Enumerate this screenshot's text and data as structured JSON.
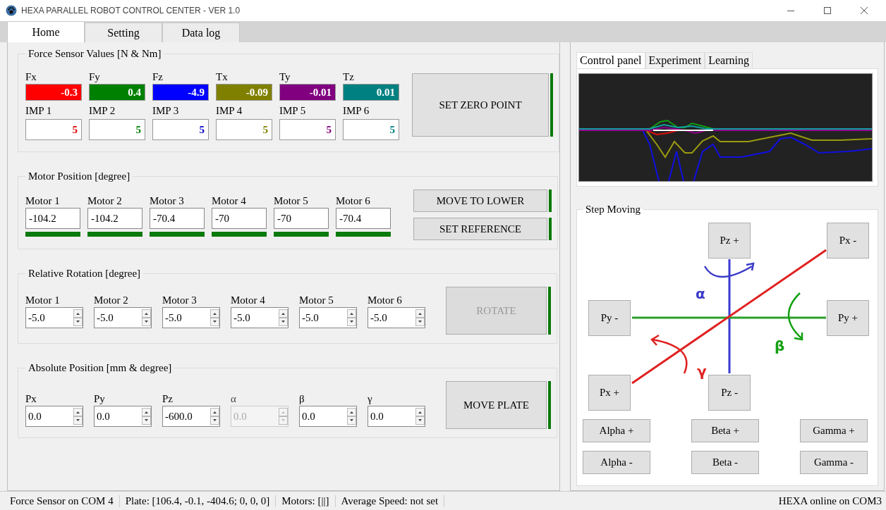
{
  "window": {
    "title": "HEXA PARALLEL ROBOT CONTROL CENTER - VER 1.0"
  },
  "tabs": [
    {
      "label": "Home",
      "selected": true
    },
    {
      "label": "Setting",
      "selected": false
    },
    {
      "label": "Data log",
      "selected": false
    }
  ],
  "force_sensor": {
    "title": "Force Sensor Values [N & Nm]",
    "values": [
      {
        "label": "Fx",
        "value": "-0.3",
        "color": "#ff0000"
      },
      {
        "label": "Fy",
        "value": "0.4",
        "color": "#008000"
      },
      {
        "label": "Fz",
        "value": "-4.9",
        "color": "#0000ff"
      },
      {
        "label": "Tx",
        "value": "-0.09",
        "color": "#808000"
      },
      {
        "label": "Ty",
        "value": "-0.01",
        "color": "#800080"
      },
      {
        "label": "Tz",
        "value": "0.01",
        "color": "#008080"
      }
    ],
    "impedance": [
      {
        "label": "IMP 1",
        "value": "5",
        "color": "#e00000"
      },
      {
        "label": "IMP 2",
        "value": "5",
        "color": "#008000"
      },
      {
        "label": "IMP 3",
        "value": "5",
        "color": "#0000c0"
      },
      {
        "label": "IMP 4",
        "value": "5",
        "color": "#808000"
      },
      {
        "label": "IMP 5",
        "value": "5",
        "color": "#800080"
      },
      {
        "label": "IMP 6",
        "value": "5",
        "color": "#008080"
      }
    ],
    "button": {
      "label": "SET ZERO POINT",
      "ready": true,
      "disabled": false
    }
  },
  "motor_position": {
    "title": "Motor Position [degree]",
    "motors": [
      {
        "label": "Motor 1",
        "value": "-104.2",
        "ok": true
      },
      {
        "label": "Motor 2",
        "value": "-104.2",
        "ok": true
      },
      {
        "label": "Motor 3",
        "value": "-70.4",
        "ok": true
      },
      {
        "label": "Motor 4",
        "value": "-70",
        "ok": true
      },
      {
        "label": "Motor 5",
        "value": "-70",
        "ok": true
      },
      {
        "label": "Motor 6",
        "value": "-70.4",
        "ok": true
      }
    ],
    "buttons": [
      {
        "label": "MOVE TO LOWER",
        "ready": true,
        "disabled": false
      },
      {
        "label": "SET REFERENCE",
        "ready": true,
        "disabled": false
      }
    ]
  },
  "relative_rotation": {
    "title": "Relative Rotation [degree]",
    "fields": [
      {
        "label": "Motor 1",
        "value": "-5.0",
        "disabled": false
      },
      {
        "label": "Motor 2",
        "value": "-5.0",
        "disabled": false
      },
      {
        "label": "Motor 3",
        "value": "-5.0",
        "disabled": false
      },
      {
        "label": "Motor 4",
        "value": "-5.0",
        "disabled": false
      },
      {
        "label": "Motor 5",
        "value": "-5.0",
        "disabled": false
      },
      {
        "label": "Motor 6",
        "value": "-5.0",
        "disabled": false
      }
    ],
    "button": {
      "label": "ROTATE",
      "ready": true,
      "disabled": true
    }
  },
  "absolute_position": {
    "title": "Absolute Position [mm & degree]",
    "fields": [
      {
        "label": "Px",
        "value": "0.0",
        "disabled": false
      },
      {
        "label": "Py",
        "value": "0.0",
        "disabled": false
      },
      {
        "label": "Pz",
        "value": "-600.0",
        "disabled": false
      },
      {
        "label": "α",
        "value": "0.0",
        "disabled": true
      },
      {
        "label": "β",
        "value": "0.0",
        "disabled": false
      },
      {
        "label": "γ",
        "value": "0.0",
        "disabled": false
      }
    ],
    "button": {
      "label": "MOVE PLATE",
      "ready": true,
      "disabled": false
    }
  },
  "side_tabs": [
    {
      "label": "Control panel",
      "selected": true
    },
    {
      "label": "Experiment",
      "selected": false
    },
    {
      "label": "Learning",
      "selected": false
    }
  ],
  "step_moving": {
    "title": "Step Moving",
    "pad_buttons": [
      {
        "label": "Pz +"
      },
      {
        "label": "Px -"
      },
      {
        "label": "Py -"
      },
      {
        "label": "Py +"
      },
      {
        "label": "Px +"
      },
      {
        "label": "Pz -"
      }
    ],
    "axis_labels": [
      {
        "label": "α",
        "color": "#3a3ac8"
      },
      {
        "label": "β",
        "color": "#12a012"
      },
      {
        "label": "γ",
        "color": "#e02020"
      }
    ],
    "rotation_buttons": [
      {
        "label": "Alpha +"
      },
      {
        "label": "Beta +"
      },
      {
        "label": "Gamma +"
      },
      {
        "label": "Alpha -"
      },
      {
        "label": "Beta -"
      },
      {
        "label": "Gamma -"
      }
    ]
  },
  "status_bar": {
    "segments": [
      "Force Sensor on COM 4",
      "Plate: [106.4, -0.1, -404.6; 0, 0, 0]",
      "Motors: [||]",
      "Average Speed: not set"
    ],
    "right": "HEXA online on COM3"
  }
}
